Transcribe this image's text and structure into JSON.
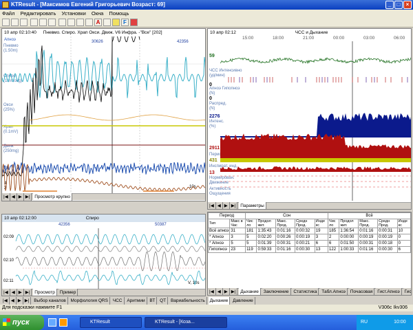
{
  "window": {
    "title": "KTResult - [Максимов Евгений Григорьевич Возраст: 69]"
  },
  "menu": [
    "Файл",
    "Редактировать",
    "Установки",
    "Окна",
    "Помощь"
  ],
  "toolbar": {
    "icon_letters": [
      "A",
      "F"
    ]
  },
  "top_left": {
    "time": "10 апр 02:10:40",
    "header": "Пневмо. Спиро. Храп Окси. Движ. V6 Инфра. -\"Все\" [202]",
    "channel": "Апноэ",
    "values": [
      "30626",
      "42356"
    ],
    "labels": [
      "Пневмо\n(1.50m)",
      "Спиро\n(1mmol/g)",
      "Окси\n(25%)",
      "Храп\n(0.1mV)",
      "Движ\n(250mg)",
      "V6\n(1mV)"
    ],
    "y_marks": [
      "4\n2",
      "10s"
    ],
    "tab": "Просмотр крупно"
  },
  "top_right": {
    "time": "10 апр 02:12",
    "title": "ЧСС и Дыхание",
    "hours": [
      "15:00",
      "18:00",
      "21:00",
      "00:00",
      "03:00",
      "06:00"
    ],
    "hr_value": "59",
    "labels": [
      "ЧСС Интенсивно\n(уд/мин)",
      "Апноэ Гипопноэ\n(N)",
      "Распред.\n(N)",
      "Интенс.\n(%)",
      "Период",
      "Инспират. инд.",
      "Нормирован.\nДвижение",
      "Активность\nОщущения"
    ],
    "values": [
      "0",
      "0",
      "2276",
      "2911",
      "431",
      "13"
    ],
    "tab": "Параметры"
  },
  "bottom_left": {
    "time": "10 апр 02:12:00",
    "channel": "Спиро",
    "values": [
      "42356",
      "50387"
    ],
    "y_marks": [
      "02:09",
      "02:10",
      "02:11",
      "V, 10s"
    ],
    "tabs": [
      "Просмотр",
      "Пример"
    ]
  },
  "table": {
    "group_headers": [
      "Период",
      "Сон",
      "Всё"
    ],
    "columns": [
      "Тип",
      "Макс в Час",
      "Чис ло",
      "Продол жит.",
      "Макс. Прод.",
      "Средн Прод.",
      "Инде кс",
      "Чис ло",
      "Продол жит.",
      "Макс. Прод.",
      "Средн Прод.",
      "Инде кс"
    ],
    "rows": [
      [
        "Всё апноэ",
        "31",
        "181",
        "1:35:43",
        "0:01:16",
        "0:00:32",
        "19",
        "185",
        "1:36:54",
        "0:01:16",
        "0:00:31",
        "10"
      ],
      [
        "* Апноэ",
        "3",
        "5",
        "0:02:20",
        "0:00:26",
        "0:00:19",
        "3",
        "2",
        "0:00:00",
        "0:00:19",
        "0:00:19",
        "0"
      ],
      [
        "* Апноэ",
        "5",
        "5",
        "0:01:39",
        "0:00:31",
        "0:00:21",
        "6",
        "6",
        "0:01:50",
        "0:00:31",
        "0:00:18",
        "0"
      ],
      [
        "Гипопноэ",
        "23",
        "119",
        "0:59:33",
        "0:01:16",
        "0:00:30",
        "13",
        "122",
        "1:00:33",
        "0:01:16",
        "0:00:30",
        "6"
      ]
    ]
  },
  "bottom_tabs": [
    "Выбор каналов",
    "Морфология QRS",
    "ЧСС",
    "Аритмии",
    "ВТ",
    "QT",
    "Вариабельность",
    "Дыхание",
    "Давление"
  ],
  "bottom_tabs_right": [
    "Дыхание",
    "Заключение",
    "Статистика",
    "Табл.Апноэ",
    "Почасовая",
    "Гист.Апноэ",
    "Гист. Дыхан"
  ],
  "status": {
    "hint": "Для подсказки нажмите F1",
    "version": "V306c  Ikv306"
  },
  "taskbar": {
    "start": "пуск",
    "task1": "KTResult",
    "task2": "KTResult - [Коза...",
    "lang": "RU",
    "clock": "10:00"
  },
  "colors": {
    "cyan": "#3ab0c8",
    "navy": "#0b1a8c",
    "red": "#b01010",
    "olive": "#c8c800",
    "brown": "#a05020",
    "blue": "#2050b0",
    "green": "#207020"
  }
}
